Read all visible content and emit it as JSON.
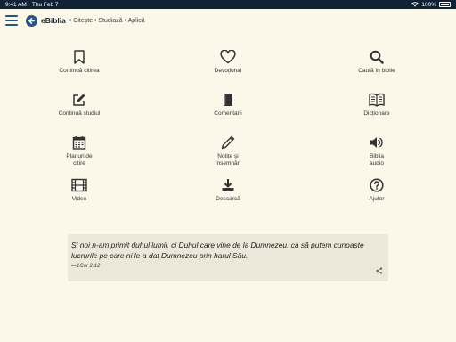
{
  "status_bar": {
    "time": "9:41 AM",
    "date": "Thu Feb 7",
    "battery": "100%"
  },
  "header": {
    "title": "eBiblia",
    "subtitle": "• Citește • Studiază • Aplică"
  },
  "menu": [
    {
      "label": "Continuă citirea",
      "icon": "bookmark-icon"
    },
    {
      "label": "Devoțional",
      "icon": "heart-icon"
    },
    {
      "label": "Caută în biblie",
      "icon": "search-icon"
    },
    {
      "label": "Continuă studiul",
      "icon": "edit-icon"
    },
    {
      "label": "Comentarii",
      "icon": "book-icon"
    },
    {
      "label": "Dicționare",
      "icon": "open-book-icon"
    },
    {
      "label": "Planuri de\ncitire",
      "icon": "calendar-icon"
    },
    {
      "label": "Notițe și\nînsemnări",
      "icon": "pencil-icon"
    },
    {
      "label": "Biblia\naudio",
      "icon": "speaker-icon"
    },
    {
      "label": "Video",
      "icon": "film-icon"
    },
    {
      "label": "Descarcă",
      "icon": "download-icon"
    },
    {
      "label": "Ajutor",
      "icon": "help-icon"
    }
  ],
  "verse": {
    "text": "Și noi n-am primit duhul lumii, ci Duhul care vine de la Dumnezeu, ca să putem cunoaște lucrurile pe care ni le-a dat Dumnezeu prin harul Său.",
    "reference": "—1Cor 2:12"
  },
  "colors": {
    "accent": "#27557c",
    "background": "#fbf8e9",
    "icon": "#333333"
  }
}
